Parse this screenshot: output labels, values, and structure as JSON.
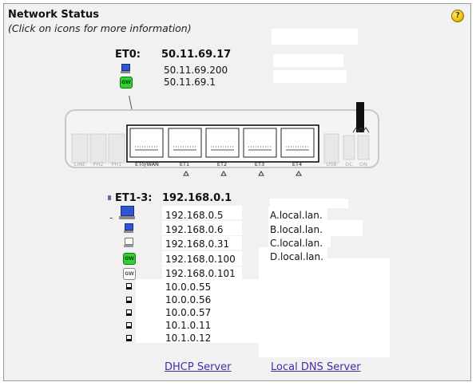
{
  "header": {
    "title": "Network Status",
    "subtitle": "(Click on icons for more information)"
  },
  "et0": {
    "label": "ET0:",
    "ip": "50.11.69.17",
    "addresses": [
      "50.11.69.200",
      "50.11.69.1"
    ]
  },
  "router": {
    "ports": {
      "line": "LINE",
      "ph2": "PH2",
      "ph1": "PH1",
      "et0": "ET0/WAN",
      "et1": "ET1",
      "et2": "ET2",
      "et3": "ET3",
      "et4": "ET4",
      "usb": "USB",
      "dc": "DC",
      "on": "ON"
    }
  },
  "et13": {
    "label": "ET1-3:",
    "ip": "192.168.0.1",
    "clients": [
      {
        "ip": "192.168.0.5",
        "icon": "computer-icon",
        "name": "A.local.lan."
      },
      {
        "ip": "192.168.0.6",
        "icon": "computer-icon",
        "name": "B.local.lan."
      },
      {
        "ip": "192.168.0.31",
        "icon": "computer-icon",
        "name": "C.local.lan."
      },
      {
        "ip": "192.168.0.100",
        "icon": "gateway-icon",
        "name": "D.local.lan."
      },
      {
        "ip": "192.168.0.101",
        "icon": "gateway-icon"
      },
      {
        "ip": "10.0.0.55",
        "icon": "phone-icon"
      },
      {
        "ip": "10.0.0.56",
        "icon": "phone-icon"
      },
      {
        "ip": "10.0.0.57",
        "icon": "phone-icon"
      },
      {
        "ip": "10.1.0.11",
        "icon": "phone-icon"
      },
      {
        "ip": "10.1.0.12",
        "icon": "phone-icon"
      }
    ]
  },
  "footer": {
    "dhcp_link": "DHCP Server",
    "dns_link": "Local DNS Server"
  },
  "colors": {
    "panel_bg": "#f1f1f1",
    "link": "#4a2aa8",
    "gateway_green": "#2fd02f",
    "computer_blue": "#2f55d6"
  }
}
